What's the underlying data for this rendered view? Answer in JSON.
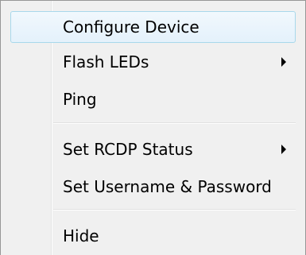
{
  "menu": {
    "items": [
      {
        "label": "Configure Device",
        "submenu": false,
        "highlighted": true
      },
      {
        "label": "Flash LEDs",
        "submenu": true,
        "highlighted": false
      },
      {
        "label": "Ping",
        "submenu": false,
        "highlighted": false
      },
      {
        "label": "Set RCDP Status",
        "submenu": true,
        "highlighted": false
      },
      {
        "label": "Set Username & Password",
        "submenu": false,
        "highlighted": false
      },
      {
        "label": "Hide",
        "submenu": false,
        "highlighted": false
      }
    ],
    "submenu_arrow_icon": "triangle-right-icon",
    "colors": {
      "background": "#f0f0f0",
      "highlight_border": "#a8d8eb",
      "highlight_fill": "#e4f1fb",
      "border": "#979797"
    }
  }
}
